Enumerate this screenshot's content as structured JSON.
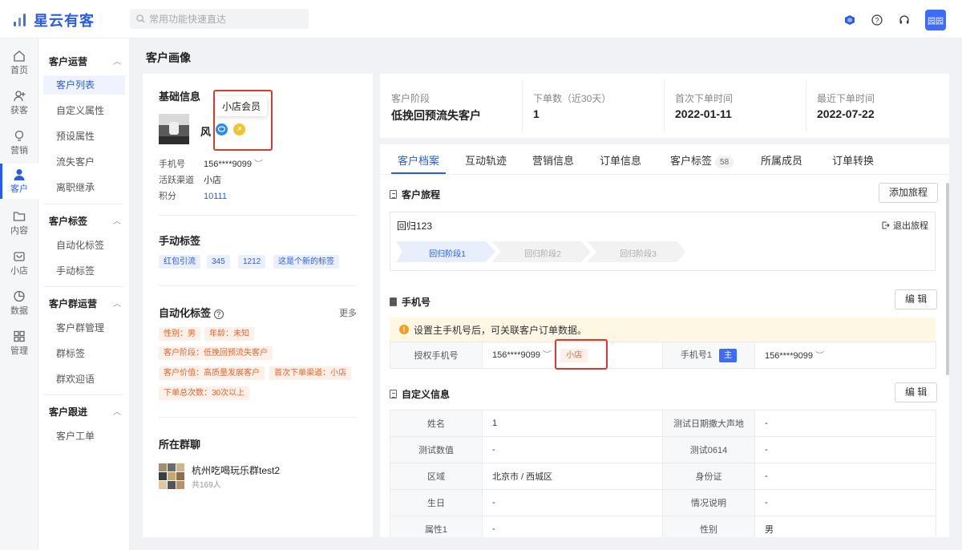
{
  "app": {
    "logo_text": "星云有客",
    "search_placeholder": "常用功能快速直达",
    "avatar_text": "园园"
  },
  "rail": [
    {
      "label": "首页",
      "icon": "home-icon"
    },
    {
      "label": "获客",
      "icon": "user-plus-icon"
    },
    {
      "label": "营销",
      "icon": "bulb-icon"
    },
    {
      "label": "客户",
      "icon": "user-icon"
    },
    {
      "label": "内容",
      "icon": "folder-icon"
    },
    {
      "label": "小店",
      "icon": "shop-icon"
    },
    {
      "label": "数据",
      "icon": "pie-icon"
    },
    {
      "label": "管理",
      "icon": "grid-icon"
    }
  ],
  "submenu": {
    "g1": {
      "title": "客户运营",
      "items": [
        "客户列表",
        "自定义属性",
        "预设属性",
        "流失客户",
        "离职继承"
      ]
    },
    "g2": {
      "title": "客户标签",
      "items": [
        "自动化标签",
        "手动标签"
      ]
    },
    "g3": {
      "title": "客户群运营",
      "items": [
        "客户群管理",
        "群标签",
        "群欢迎语"
      ]
    },
    "g4": {
      "title": "客户跟进",
      "items": [
        "客户工单"
      ]
    }
  },
  "page": {
    "title": "客户画像"
  },
  "basic": {
    "title": "基础信息",
    "name": "风",
    "tooltip": "小店会员",
    "phone_label": "手机号",
    "phone_value": "156****9099",
    "channel_label": "活跃渠道",
    "channel_value": "小店",
    "points_label": "积分",
    "points_value": "10111"
  },
  "manual_tags": {
    "title": "手动标签",
    "tags": [
      "红包引流",
      "345",
      "1212",
      "这是个新的标签"
    ]
  },
  "auto_tags": {
    "title": "自动化标签",
    "more": "更多",
    "tags": [
      "性别：男",
      "年龄：未知",
      "客户阶段：低挽回预流失客户",
      "客户价值：高质量发展客户",
      "首次下单渠道：小店",
      "下单总次数：30次以上"
    ]
  },
  "groups": {
    "title": "所在群聊",
    "name": "杭州吃喝玩乐群test2",
    "count": "共169人"
  },
  "stats": [
    {
      "label": "客户阶段",
      "value": "低挽回预流失客户"
    },
    {
      "label": "下单数（近30天）",
      "value": "1"
    },
    {
      "label": "首次下单时间",
      "value": "2022-01-11"
    },
    {
      "label": "最近下单时间",
      "value": "2022-07-22"
    }
  ],
  "tabs": [
    "客户档案",
    "互动轨迹",
    "营销信息",
    "订单信息",
    "客户标签",
    "所属成员",
    "订单转换"
  ],
  "tab_tag_count": "58",
  "journey": {
    "title": "客户旅程",
    "add_button": "添加旅程",
    "name": "回归123",
    "exit": "退出旅程",
    "steps": [
      "回归阶段1",
      "回归阶段2",
      "回归阶段3"
    ]
  },
  "phone": {
    "title": "手机号",
    "edit": "编 辑",
    "notice": "设置主手机号后，可关联客户订单数据。",
    "auth_label": "授权手机号",
    "auth_value": "156****9099",
    "auth_tag": "小店",
    "phone1_label": "手机号1",
    "primary_badge": "主",
    "phone1_value": "156****9099"
  },
  "custom": {
    "title": "自定义信息",
    "edit": "编 辑",
    "rows": [
      [
        "姓名",
        "1",
        "测试日期撒大声地",
        "-"
      ],
      [
        "测试数值",
        "-",
        "测试0614",
        "-"
      ],
      [
        "区域",
        "北京市 / 西城区",
        "身份证",
        "-"
      ],
      [
        "生日",
        "-",
        "情况说明",
        "-"
      ],
      [
        "属性1",
        "-",
        "性别",
        "男"
      ]
    ]
  }
}
